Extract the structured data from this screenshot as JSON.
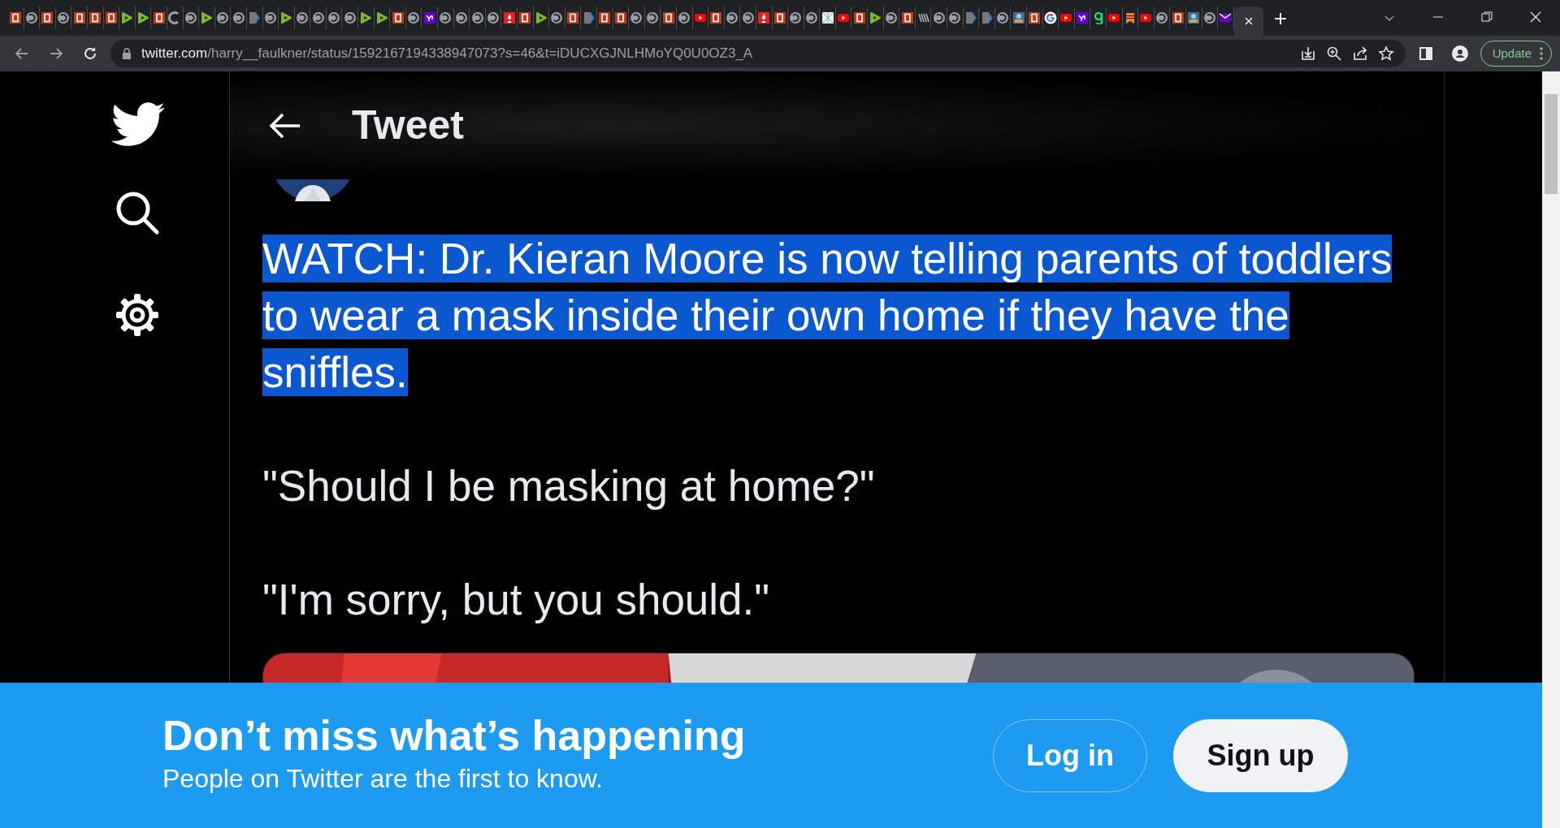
{
  "browser": {
    "tabs": [
      {
        "kind": "b",
        "selected": false
      },
      {
        "kind": "globe",
        "selected": false
      },
      {
        "kind": "b",
        "selected": false
      },
      {
        "kind": "globe",
        "selected": false
      },
      {
        "kind": "b",
        "selected": false
      },
      {
        "kind": "b",
        "selected": false
      },
      {
        "kind": "b",
        "selected": false
      },
      {
        "kind": "play",
        "selected": false
      },
      {
        "kind": "play",
        "selected": false
      },
      {
        "kind": "b",
        "selected": false
      },
      {
        "kind": "load",
        "selected": false
      },
      {
        "kind": "globe",
        "selected": false
      },
      {
        "kind": "play",
        "selected": false
      },
      {
        "kind": "globe",
        "selected": false
      },
      {
        "kind": "globe",
        "selected": false
      },
      {
        "kind": "arrow",
        "selected": false
      },
      {
        "kind": "globe",
        "selected": false
      },
      {
        "kind": "play",
        "selected": false
      },
      {
        "kind": "globe",
        "selected": false
      },
      {
        "kind": "globe",
        "selected": false
      },
      {
        "kind": "globe",
        "selected": false
      },
      {
        "kind": "globe",
        "selected": false
      },
      {
        "kind": "play",
        "selected": false
      },
      {
        "kind": "play",
        "selected": false
      },
      {
        "kind": "b",
        "selected": false
      },
      {
        "kind": "globe",
        "selected": false
      },
      {
        "kind": "yahoo",
        "selected": false
      },
      {
        "kind": "globe",
        "selected": false
      },
      {
        "kind": "globe",
        "selected": false
      },
      {
        "kind": "globe",
        "selected": false
      },
      {
        "kind": "globe",
        "selected": false
      },
      {
        "kind": "fire",
        "selected": false
      },
      {
        "kind": "b",
        "selected": false
      },
      {
        "kind": "play",
        "selected": false
      },
      {
        "kind": "globe",
        "selected": false
      },
      {
        "kind": "b",
        "selected": false
      },
      {
        "kind": "arrow",
        "selected": false
      },
      {
        "kind": "b",
        "selected": false
      },
      {
        "kind": "b",
        "selected": false
      },
      {
        "kind": "globe",
        "selected": false
      },
      {
        "kind": "globe",
        "selected": false
      },
      {
        "kind": "b",
        "selected": false
      },
      {
        "kind": "globe",
        "selected": false
      },
      {
        "kind": "video",
        "selected": false
      },
      {
        "kind": "b",
        "selected": false
      },
      {
        "kind": "globe",
        "selected": false
      },
      {
        "kind": "globe",
        "selected": false
      },
      {
        "kind": "fire",
        "selected": false
      },
      {
        "kind": "b",
        "selected": false
      },
      {
        "kind": "globe",
        "selected": false
      },
      {
        "kind": "globe",
        "selected": false
      },
      {
        "kind": "map",
        "selected": false
      },
      {
        "kind": "video",
        "selected": false
      },
      {
        "kind": "b",
        "selected": false
      },
      {
        "kind": "play",
        "selected": false
      },
      {
        "kind": "globe",
        "selected": false
      },
      {
        "kind": "b",
        "selected": false
      },
      {
        "kind": "stripes",
        "selected": false
      },
      {
        "kind": "globe",
        "selected": false
      },
      {
        "kind": "globe",
        "selected": false
      },
      {
        "kind": "arrow",
        "selected": false
      },
      {
        "kind": "arrow",
        "selected": false
      },
      {
        "kind": "globe",
        "selected": false
      },
      {
        "kind": "img",
        "selected": false
      },
      {
        "kind": "b",
        "selected": false
      },
      {
        "kind": "google",
        "selected": false
      },
      {
        "kind": "video",
        "selected": false
      },
      {
        "kind": "yahoo",
        "selected": false
      },
      {
        "kind": "g",
        "selected": false
      },
      {
        "kind": "video",
        "selected": false
      },
      {
        "kind": "bookmark",
        "selected": false
      },
      {
        "kind": "video",
        "selected": false
      },
      {
        "kind": "globe",
        "selected": false
      },
      {
        "kind": "b",
        "selected": false
      },
      {
        "kind": "img",
        "selected": false
      },
      {
        "kind": "globe",
        "selected": false
      },
      {
        "kind": "mail",
        "selected": false
      },
      {
        "kind": "none",
        "selected": true
      }
    ],
    "url": {
      "host": "twitter.com",
      "path": "/harry__faulkner/status/1592167194338947073?s=46&t=iDUCXGJNLHMoYQ0U0OZ3_A"
    },
    "update_button": "Update"
  },
  "page": {
    "header_title": "Tweet",
    "tweet": {
      "paragraphs": [
        {
          "text": "WATCH: Dr. Kieran Moore is now telling parents of toddlers to wear a mask inside their own home if they have the sniffles.",
          "selected": true
        },
        {
          "text": "\"Should I be masking at home?\"",
          "selected": false
        },
        {
          "text": "\"I'm sorry, but you should.\"",
          "selected": false
        }
      ]
    },
    "signup_banner": {
      "title": "Don’t miss what’s happening",
      "subtitle": "People on Twitter are the first to know.",
      "login_button": "Log in",
      "signup_button": "Sign up"
    }
  }
}
